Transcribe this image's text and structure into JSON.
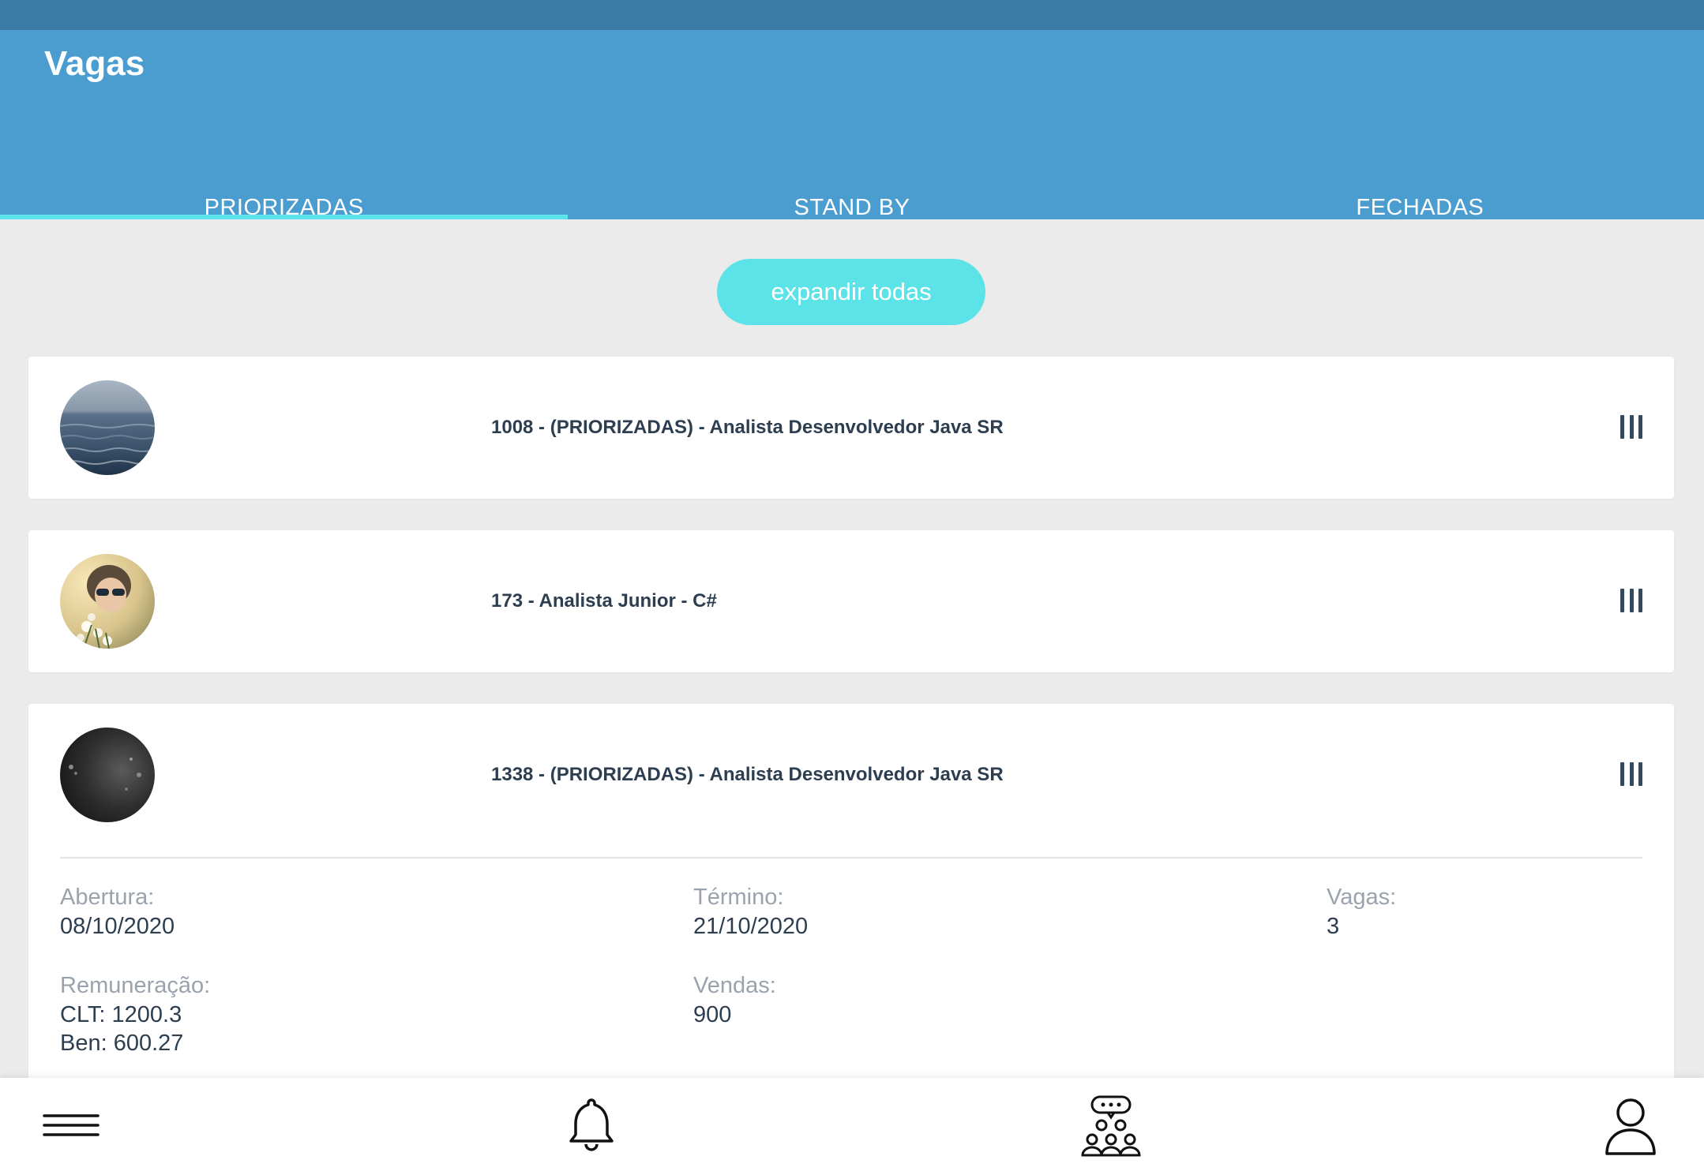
{
  "header": {
    "title": "Vagas",
    "tabs": [
      {
        "label": "PRIORIZADAS",
        "active": true
      },
      {
        "label": "STAND BY",
        "active": false
      },
      {
        "label": "FECHADAS",
        "active": false
      }
    ]
  },
  "expand_button": {
    "label": "expandir todas"
  },
  "jobs": [
    {
      "title": "1008 - (PRIORIZADAS) - Analista Desenvolvedor Java SR",
      "avatar": "ocean-photo"
    },
    {
      "title": "173 - Analista Junior - C#",
      "avatar": "woman-sunglasses-photo"
    },
    {
      "title": "1338 - (PRIORIZADAS) - Analista Desenvolvedor Java SR",
      "avatar": "dark-photo",
      "expanded": true,
      "details": {
        "abertura_label": "Abertura:",
        "abertura_value": "08/10/2020",
        "termino_label": "Término:",
        "termino_value": "21/10/2020",
        "vagas_label": "Vagas:",
        "vagas_value": "3",
        "remuneracao_label": "Remuneração:",
        "remuneracao_clt": "CLT: 1200.3",
        "remuneracao_ben": "Ben: 600.27",
        "vendas_label": "Vendas:",
        "vendas_value": "900"
      }
    }
  ],
  "bottom_nav": {
    "items": [
      "menu-icon",
      "bell-icon",
      "group-chat-icon",
      "user-icon"
    ]
  },
  "colors": {
    "header": "#4b9dd0",
    "status_bar": "#3a7ca5",
    "accent": "#5ce3e8",
    "text_dark": "#2d3e50",
    "text_muted": "#9aa3ad",
    "background": "#ebebeb"
  }
}
